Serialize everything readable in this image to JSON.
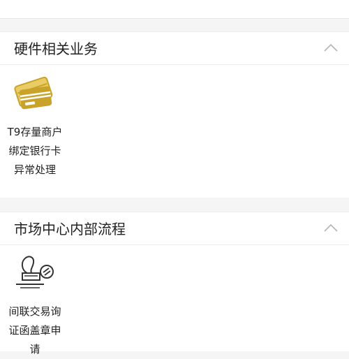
{
  "sections": [
    {
      "title": "硬件相关业务",
      "toggle_icon": "chevron-up-icon",
      "tiles": [
        {
          "icon": "bank-cards-icon",
          "label_lines": [
            "T9存量商户",
            "绑定银行卡",
            "异常处理"
          ]
        }
      ]
    },
    {
      "title": "市场中心内部流程",
      "toggle_icon": "chevron-up-icon",
      "tiles": [
        {
          "icon": "stamp-icon",
          "label_lines": [
            "间联交易询",
            "证函盖章申",
            "请"
          ]
        }
      ]
    }
  ],
  "colors": {
    "accent_gold": "#c9a22a",
    "accent_gold_light": "#e9cd64",
    "page_background": "#f5f5f5",
    "card_background": "#ffffff"
  }
}
